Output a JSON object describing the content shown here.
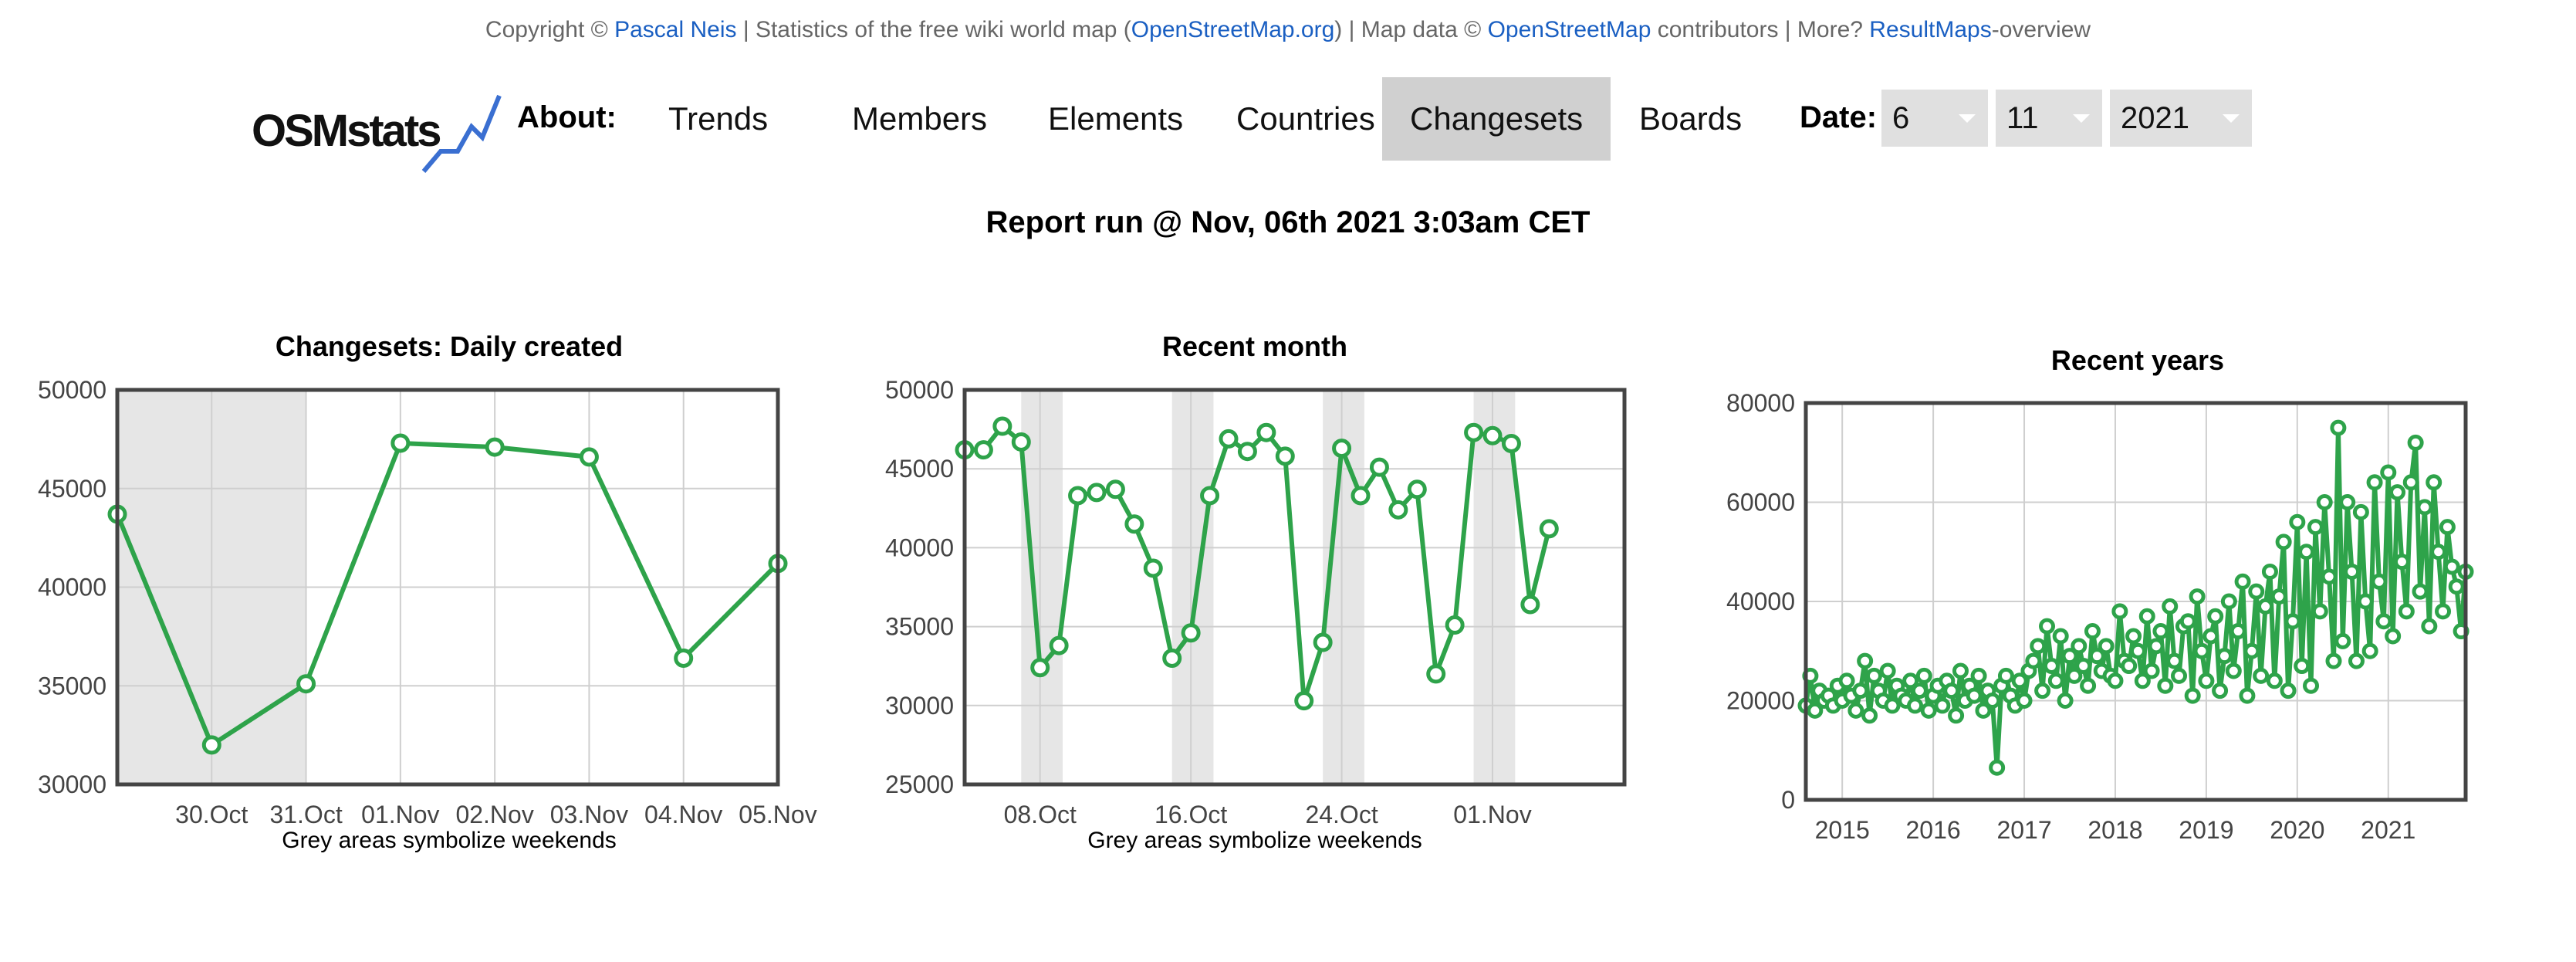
{
  "copyright": {
    "prefix": "Copyright © ",
    "author": "Pascal Neis",
    "middle1": " | Statistics of the free wiki world map (",
    "osm_org": "OpenStreetMap.org",
    "middle2": ") | Map data © ",
    "osm": "OpenStreetMap",
    "middle3": " contributors | More? ",
    "resultmaps": "ResultMaps",
    "suffix": "-overview"
  },
  "header": {
    "logo": "OSMstats",
    "about": "About:",
    "nav": [
      "Trends",
      "Members",
      "Elements",
      "Countries",
      "Changesets",
      "Boards"
    ],
    "active": "Changesets",
    "date_label": "Date:",
    "day": "6",
    "month": "11",
    "year": "2021"
  },
  "report_run": "Report run @ Nov, 06th 2021 3:03am CET",
  "colors": {
    "line": "#2ea34a",
    "link": "#1a5fc2",
    "weekend": "#e6e6e6",
    "active_tab": "#d0d0d0"
  },
  "chart_data": [
    {
      "type": "line",
      "title": "Changesets: Daily created",
      "note": "Grey areas symbolize weekends",
      "ylim": [
        30000,
        50000
      ],
      "yticks": [
        30000,
        35000,
        40000,
        45000,
        50000
      ],
      "xlim": [
        0,
        7
      ],
      "xticks": [
        {
          "x": 1,
          "label": "30.Oct"
        },
        {
          "x": 2,
          "label": "31.Oct"
        },
        {
          "x": 3,
          "label": "01.Nov"
        },
        {
          "x": 4,
          "label": "02.Nov"
        },
        {
          "x": 5,
          "label": "03.Nov"
        },
        {
          "x": 6,
          "label": "04.Nov"
        },
        {
          "x": 7,
          "label": "05.Nov"
        }
      ],
      "weekends": [
        [
          0,
          2
        ]
      ],
      "x": [
        0,
        1,
        2,
        3,
        4,
        5,
        6,
        7
      ],
      "values": [
        43700,
        32000,
        35100,
        47300,
        47100,
        46600,
        36400,
        41200
      ],
      "grid": true
    },
    {
      "type": "line",
      "title": "Recent month",
      "note": "Grey areas symbolize weekends",
      "ylim": [
        25000,
        50000
      ],
      "yticks": [
        25000,
        30000,
        35000,
        40000,
        45000,
        50000
      ],
      "xlim": [
        0,
        35
      ],
      "xticks": [
        {
          "x": 4,
          "label": "08.Oct"
        },
        {
          "x": 12,
          "label": "16.Oct"
        },
        {
          "x": 20,
          "label": "24.Oct"
        },
        {
          "x": 28,
          "label": "01.Nov"
        }
      ],
      "weekends": [
        [
          3,
          5.2
        ],
        [
          11,
          13.2
        ],
        [
          19,
          21.2
        ],
        [
          27,
          29.2
        ]
      ],
      "x": [
        0,
        1,
        2,
        3,
        4,
        5,
        6,
        7,
        8,
        9,
        10,
        11,
        12,
        13,
        14,
        15,
        16,
        17,
        18,
        19,
        20,
        21,
        22,
        23,
        24,
        25,
        26,
        27,
        28,
        29,
        30,
        31,
        32,
        33,
        34,
        35
      ],
      "values": [
        46200,
        46200,
        47700,
        46700,
        32400,
        33800,
        43300,
        43500,
        43700,
        41500,
        38700,
        33000,
        34600,
        43300,
        46900,
        46100,
        47300,
        45800,
        30300,
        34000,
        46300,
        43300,
        45100,
        42400,
        43700,
        32000,
        35100,
        47300,
        47100,
        46600,
        36400,
        41200,
        null,
        null,
        null,
        null
      ],
      "grid": true
    },
    {
      "type": "line",
      "title": "Recent years",
      "ylim": [
        0,
        80000
      ],
      "yticks": [
        0,
        20000,
        40000,
        60000,
        80000
      ],
      "xlim": [
        2014.6,
        2021.85
      ],
      "xticks": [
        {
          "x": 2015,
          "label": "2015"
        },
        {
          "x": 2016,
          "label": "2016"
        },
        {
          "x": 2017,
          "label": "2017"
        },
        {
          "x": 2018,
          "label": "2018"
        },
        {
          "x": 2019,
          "label": "2019"
        },
        {
          "x": 2020,
          "label": "2020"
        },
        {
          "x": 2021,
          "label": "2021"
        }
      ],
      "x": [
        2014.6,
        2014.65,
        2014.7,
        2014.75,
        2014.8,
        2014.85,
        2014.9,
        2014.95,
        2015.0,
        2015.05,
        2015.1,
        2015.15,
        2015.2,
        2015.25,
        2015.3,
        2015.35,
        2015.4,
        2015.45,
        2015.5,
        2015.55,
        2015.6,
        2015.65,
        2015.7,
        2015.75,
        2015.8,
        2015.85,
        2015.9,
        2015.95,
        2016.0,
        2016.05,
        2016.1,
        2016.15,
        2016.2,
        2016.25,
        2016.3,
        2016.35,
        2016.4,
        2016.45,
        2016.5,
        2016.55,
        2016.6,
        2016.65,
        2016.7,
        2016.75,
        2016.8,
        2016.85,
        2016.9,
        2016.95,
        2017.0,
        2017.05,
        2017.1,
        2017.15,
        2017.2,
        2017.25,
        2017.3,
        2017.35,
        2017.4,
        2017.45,
        2017.5,
        2017.55,
        2017.6,
        2017.65,
        2017.7,
        2017.75,
        2017.8,
        2017.85,
        2017.9,
        2017.95,
        2018.0,
        2018.05,
        2018.1,
        2018.15,
        2018.2,
        2018.25,
        2018.3,
        2018.35,
        2018.4,
        2018.45,
        2018.5,
        2018.55,
        2018.6,
        2018.65,
        2018.7,
        2018.75,
        2018.8,
        2018.85,
        2018.9,
        2018.95,
        2019.0,
        2019.05,
        2019.1,
        2019.15,
        2019.2,
        2019.25,
        2019.3,
        2019.35,
        2019.4,
        2019.45,
        2019.5,
        2019.55,
        2019.6,
        2019.65,
        2019.7,
        2019.75,
        2019.8,
        2019.85,
        2019.9,
        2019.95,
        2020.0,
        2020.05,
        2020.1,
        2020.15,
        2020.2,
        2020.25,
        2020.3,
        2020.35,
        2020.4,
        2020.45,
        2020.5,
        2020.55,
        2020.6,
        2020.65,
        2020.7,
        2020.75,
        2020.8,
        2020.85,
        2020.9,
        2020.95,
        2021.0,
        2021.05,
        2021.1,
        2021.15,
        2021.2,
        2021.25,
        2021.3,
        2021.35,
        2021.4,
        2021.45,
        2021.5,
        2021.55,
        2021.6,
        2021.65,
        2021.7,
        2021.75,
        2021.8,
        2021.85
      ],
      "values": [
        19000,
        25000,
        18000,
        22000,
        20000,
        21000,
        19000,
        23000,
        20000,
        24000,
        21000,
        18000,
        22000,
        28000,
        17000,
        25000,
        22000,
        20000,
        26000,
        19000,
        23000,
        21000,
        20000,
        24000,
        19000,
        22000,
        25000,
        18000,
        21000,
        23000,
        19000,
        24000,
        22000,
        17000,
        26000,
        20000,
        23000,
        21000,
        25000,
        18000,
        22000,
        20000,
        6500,
        23000,
        25000,
        21000,
        19000,
        24000,
        20000,
        26000,
        28000,
        31000,
        22000,
        35000,
        27000,
        24000,
        33000,
        20000,
        29000,
        25000,
        31000,
        27000,
        23000,
        34000,
        29000,
        26000,
        31000,
        25000,
        24000,
        38000,
        28000,
        27000,
        33000,
        30000,
        24000,
        37000,
        26000,
        31000,
        34000,
        23000,
        39000,
        28000,
        25000,
        35000,
        36000,
        21000,
        41000,
        30000,
        24000,
        33000,
        37000,
        22000,
        29000,
        40000,
        26000,
        34000,
        44000,
        21000,
        30000,
        42000,
        25000,
        39000,
        46000,
        24000,
        41000,
        52000,
        22000,
        36000,
        56000,
        27000,
        50000,
        23000,
        55000,
        38000,
        60000,
        45000,
        28000,
        75000,
        32000,
        60000,
        46000,
        28000,
        58000,
        40000,
        30000,
        64000,
        44000,
        36000,
        66000,
        33000,
        62000,
        48000,
        38000,
        64000,
        72000,
        42000,
        59000,
        35000,
        64000,
        50000,
        38000,
        55000,
        47000,
        43000,
        34000,
        46000
      ],
      "grid": true
    }
  ]
}
